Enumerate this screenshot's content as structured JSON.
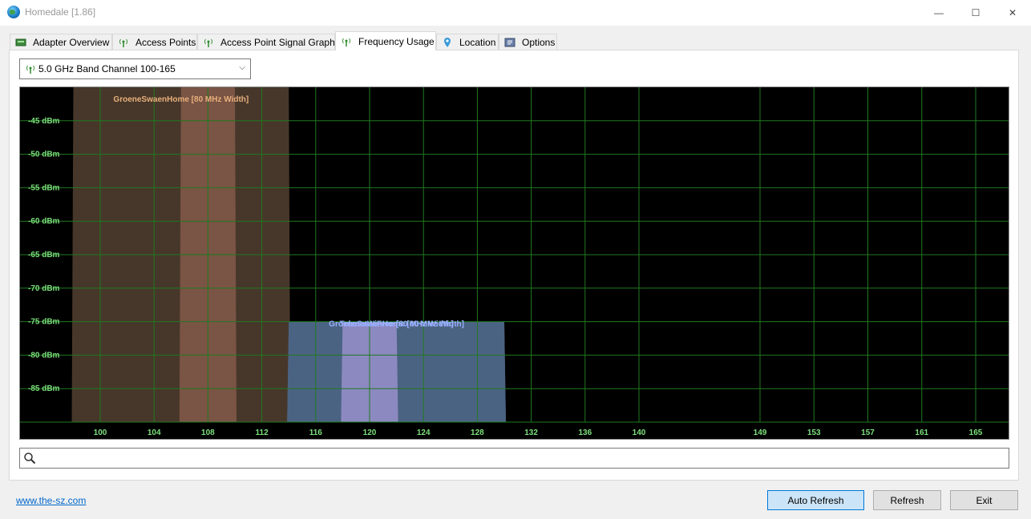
{
  "window": {
    "title": "Homedale [1.86]",
    "minimize_glyph": "—",
    "maximize_glyph": "☐",
    "close_glyph": "✕"
  },
  "tabs": [
    {
      "label": "Adapter Overview",
      "icon": "adapter-icon",
      "active": false
    },
    {
      "label": "Access Points",
      "icon": "antenna-icon",
      "active": false
    },
    {
      "label": "Access Point Signal Graph",
      "icon": "antenna-icon",
      "active": false
    },
    {
      "label": "Frequency Usage",
      "icon": "antenna-icon",
      "active": true
    },
    {
      "label": "Location",
      "icon": "location-pin-icon",
      "active": false
    },
    {
      "label": "Options",
      "icon": "options-icon",
      "active": false
    }
  ],
  "band_select": {
    "value": "5.0 GHz Band Channel 100-165",
    "icon": "antenna-icon"
  },
  "chart_data": {
    "type": "area",
    "y_tick_labels": [
      "-45 dBm",
      "-50 dBm",
      "-55 dBm",
      "-60 dBm",
      "-65 dBm",
      "-70 dBm",
      "-75 dBm",
      "-80 dBm",
      "-85 dBm"
    ],
    "y_ticks": [
      -45,
      -50,
      -55,
      -60,
      -65,
      -70,
      -75,
      -80,
      -85
    ],
    "ylim": [
      -90,
      -40
    ],
    "x_tick_labels": [
      "100",
      "104",
      "108",
      "112",
      "116",
      "120",
      "124",
      "128",
      "132",
      "136",
      "140",
      "149",
      "153",
      "157",
      "161",
      "165"
    ],
    "x_channels": [
      100,
      104,
      108,
      112,
      116,
      120,
      124,
      128,
      132,
      136,
      140,
      149,
      153,
      157,
      161,
      165
    ],
    "grid": true,
    "colors": {
      "background": "#000000",
      "grid": "#1f7a1f",
      "tick_label": "#7be07b",
      "brown_network": "#4b3a2c",
      "brown_core": "#7d5546",
      "blue_network": "#4c6384",
      "blue_core": "#8f8bc3",
      "blue_label": "#9ab0ff",
      "brown_label": "#e8b07c"
    },
    "networks": [
      {
        "name": "GroeneSwaenHome",
        "label": "GroeneSwaenHome [80 MHz Width]",
        "channel_from": 98,
        "channel_to": 114,
        "core_from": 106,
        "core_to": 110,
        "dbm": -40,
        "color": "#4b3a2c",
        "core_color": "#7d5546",
        "label_color": "#e8b07c"
      },
      {
        "name": "GroeneSwaenHome",
        "label": "GroeneSwaenHome [80 MHz Width]",
        "channel_from": 114,
        "channel_to": 130,
        "core_from": 118,
        "core_to": 122,
        "dbm": -75,
        "color": "#4c6384",
        "core_color": "#8f8bc3",
        "label_color": "#9ab0ff"
      },
      {
        "name": "TelenetWiFree",
        "label": "TelenetWiFree [80 MHz Width]",
        "channel_from": 114,
        "channel_to": 130,
        "core_from": 118,
        "core_to": 122,
        "dbm": -75,
        "color": "#4c6384",
        "core_color": "#8f8bc3",
        "label_color": "#9ab0ff"
      }
    ]
  },
  "search": {
    "placeholder": "",
    "icon": "search-icon"
  },
  "footer": {
    "link": "www.the-sz.com",
    "auto_refresh_label": "Auto Refresh",
    "refresh_label": "Refresh",
    "exit_label": "Exit"
  }
}
